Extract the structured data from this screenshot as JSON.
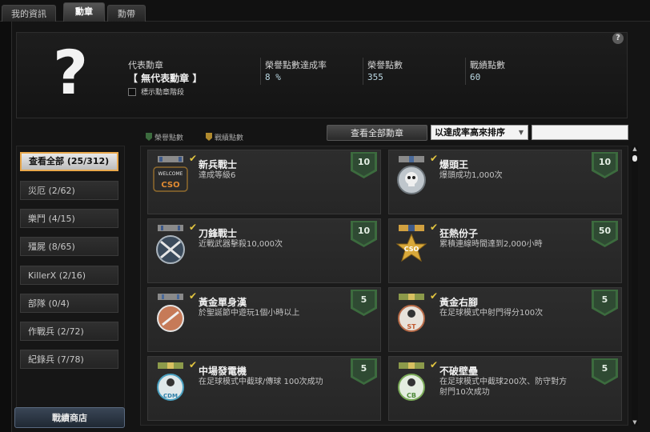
{
  "tabs": [
    {
      "label": "我的資訊"
    },
    {
      "label": "勳章"
    },
    {
      "label": "勳帶"
    }
  ],
  "info": {
    "question_mark": "?",
    "help_label": "?",
    "rep_label": "代表勳章",
    "rep_value": "【 無代表勳章 】",
    "show_stage_label": "標示勳章階段",
    "rate_label": "榮譽點數達成率",
    "rate_value": "8 %",
    "honor_label": "榮譽點數",
    "honor_value": "355",
    "battle_label": "戰績點數",
    "battle_value": "60"
  },
  "legend": {
    "honor": "榮譽點數",
    "battle": "戰績點數"
  },
  "controls": {
    "view_all": "查看全部勳章",
    "sort_value": "以達成率高來排序",
    "search_placeholder": ""
  },
  "sidebar": {
    "items": [
      {
        "label": "查看全部 (25/312)"
      },
      {
        "label": "災厄 (2/62)"
      },
      {
        "label": "樂鬥 (4/15)"
      },
      {
        "label": "殭屍 (8/65)"
      },
      {
        "label": "KillerX (2/16)"
      },
      {
        "label": "部隊 (0/4)"
      },
      {
        "label": "作戰兵 (2/72)"
      },
      {
        "label": "紀錄兵 (7/78)"
      }
    ],
    "shop": "戰績商店"
  },
  "medals": [
    {
      "name": "新兵戰士",
      "desc": "達成等級6",
      "points": "10",
      "badge_text": "CSO",
      "ribbon_text": "WELCOME"
    },
    {
      "name": "爆頭王",
      "desc": "爆頭成功1,000次",
      "points": "10",
      "badge_text": "",
      "ribbon_text": ""
    },
    {
      "name": "刀鋒戰士",
      "desc": "近戰武器擊殺10,000次",
      "points": "10",
      "badge_text": "",
      "ribbon_text": ""
    },
    {
      "name": "狂熱份子",
      "desc": "累積連線時間達到2,000小時",
      "points": "50",
      "badge_text": "CSO",
      "ribbon_text": ""
    },
    {
      "name": "黃金單身漢",
      "desc": "於聖誕節中遊玩1個小時以上",
      "points": "5",
      "badge_text": "",
      "ribbon_text": ""
    },
    {
      "name": "黃金右腳",
      "desc": "在足球模式中射門得分100次",
      "points": "5",
      "badge_text": "ST",
      "ribbon_text": ""
    },
    {
      "name": "中場發電機",
      "desc": "在足球模式中截球/傳球 100次成功",
      "points": "5",
      "badge_text": "CDM",
      "ribbon_text": ""
    },
    {
      "name": "不破壁壘",
      "desc": "在足球模式中截球200次、防守對方射門10次成功",
      "points": "5",
      "badge_text": "CB",
      "ribbon_text": ""
    }
  ],
  "colors": {
    "accent_orange": "#e9a94d",
    "check_yellow": "#e3c640",
    "honor_green": "#3c6b3e"
  }
}
